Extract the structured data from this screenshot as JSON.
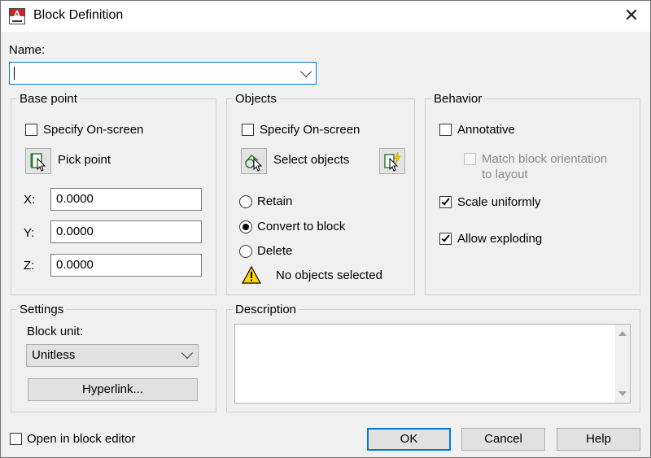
{
  "window": {
    "title": "Block Definition",
    "close_glyph": "✕"
  },
  "name": {
    "label": "Name:",
    "value": ""
  },
  "base_point": {
    "legend": "Base point",
    "specify_on_screen": {
      "label": "Specify On-screen",
      "checked": false
    },
    "pick_point_label": "Pick point",
    "x": {
      "label": "X:",
      "value": "0.0000"
    },
    "y": {
      "label": "Y:",
      "value": "0.0000"
    },
    "z": {
      "label": "Z:",
      "value": "0.0000"
    }
  },
  "objects": {
    "legend": "Objects",
    "specify_on_screen": {
      "label": "Specify On-screen",
      "checked": false
    },
    "select_objects_label": "Select objects",
    "radios": [
      {
        "label": "Retain",
        "selected": false
      },
      {
        "label": "Convert to block",
        "selected": true
      },
      {
        "label": "Delete",
        "selected": false
      }
    ],
    "status": "No objects selected"
  },
  "behavior": {
    "legend": "Behavior",
    "annotative": {
      "label": "Annotative",
      "checked": false
    },
    "match_orientation": {
      "label_line1": "Match block orientation",
      "label_line2": "to layout",
      "checked": false,
      "enabled": false
    },
    "scale_uniformly": {
      "label": "Scale uniformly",
      "checked": true
    },
    "allow_exploding": {
      "label": "Allow exploding",
      "checked": true
    }
  },
  "settings": {
    "legend": "Settings",
    "block_unit_label": "Block unit:",
    "block_unit_value": "Unitless",
    "hyperlink_label": "Hyperlink..."
  },
  "description": {
    "legend": "Description",
    "value": ""
  },
  "footer": {
    "open_in_editor": {
      "label": "Open in block editor",
      "checked": false
    },
    "ok_label": "OK",
    "cancel_label": "Cancel",
    "help_label": "Help"
  },
  "colors": {
    "accent": "#0078d7",
    "warning": "#ffd400"
  }
}
